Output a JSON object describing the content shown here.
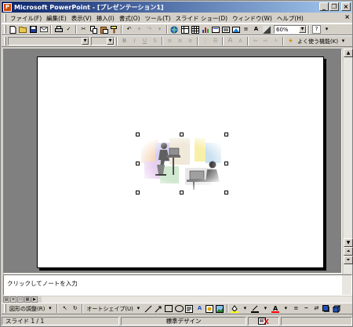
{
  "window": {
    "title": "Microsoft PowerPoint - [プレゼンテーション1]",
    "app_icon": "P"
  },
  "title_buttons": {
    "minimize": "_",
    "restore": "❐",
    "close": "×"
  },
  "menubar": {
    "items": [
      "ファイル(F)",
      "編集(E)",
      "表示(V)",
      "挿入(I)",
      "書式(O)",
      "ツール(T)",
      "スライド ショー(D)",
      "ウィンドウ(W)",
      "ヘルプ(H)"
    ],
    "close_doc": "×"
  },
  "standard_toolbar": {
    "icons": [
      "new-icon",
      "open-icon",
      "save-icon",
      "email-icon",
      "print-icon",
      "spelling-icon",
      "cut-icon",
      "copy-icon",
      "paste-icon",
      "format-painter-icon",
      "undo-icon",
      "redo-icon",
      "hyperlink-icon",
      "tables-borders-icon",
      "insert-table-icon",
      "insert-chart-icon",
      "new-slide-icon",
      "slide-layout-icon",
      "apply-design-icon",
      "expand-icon",
      "show-formatting-icon",
      "grayscale-icon"
    ],
    "zoom": "60%",
    "help": "?"
  },
  "formatting_toolbar": {
    "font_name": "",
    "font_size": "",
    "bold": "B",
    "italic": "I",
    "underline": "U",
    "shadow": "S",
    "grow_font": "A",
    "shrink_font": "A",
    "common_tasks": "よく使う機能(K)"
  },
  "slide": {
    "clipart": "people-at-computers-clipart"
  },
  "notes": {
    "placeholder": "クリックしてノートを入力"
  },
  "drawing_toolbar": {
    "draw_menu": "図形の調整(R)",
    "autoshapes_menu": "オートシェイプ(U)"
  },
  "statusbar": {
    "slide_position": "スライド 1 / 1",
    "design": "標準デザイン",
    "language_icon": "spell-status-icon"
  }
}
